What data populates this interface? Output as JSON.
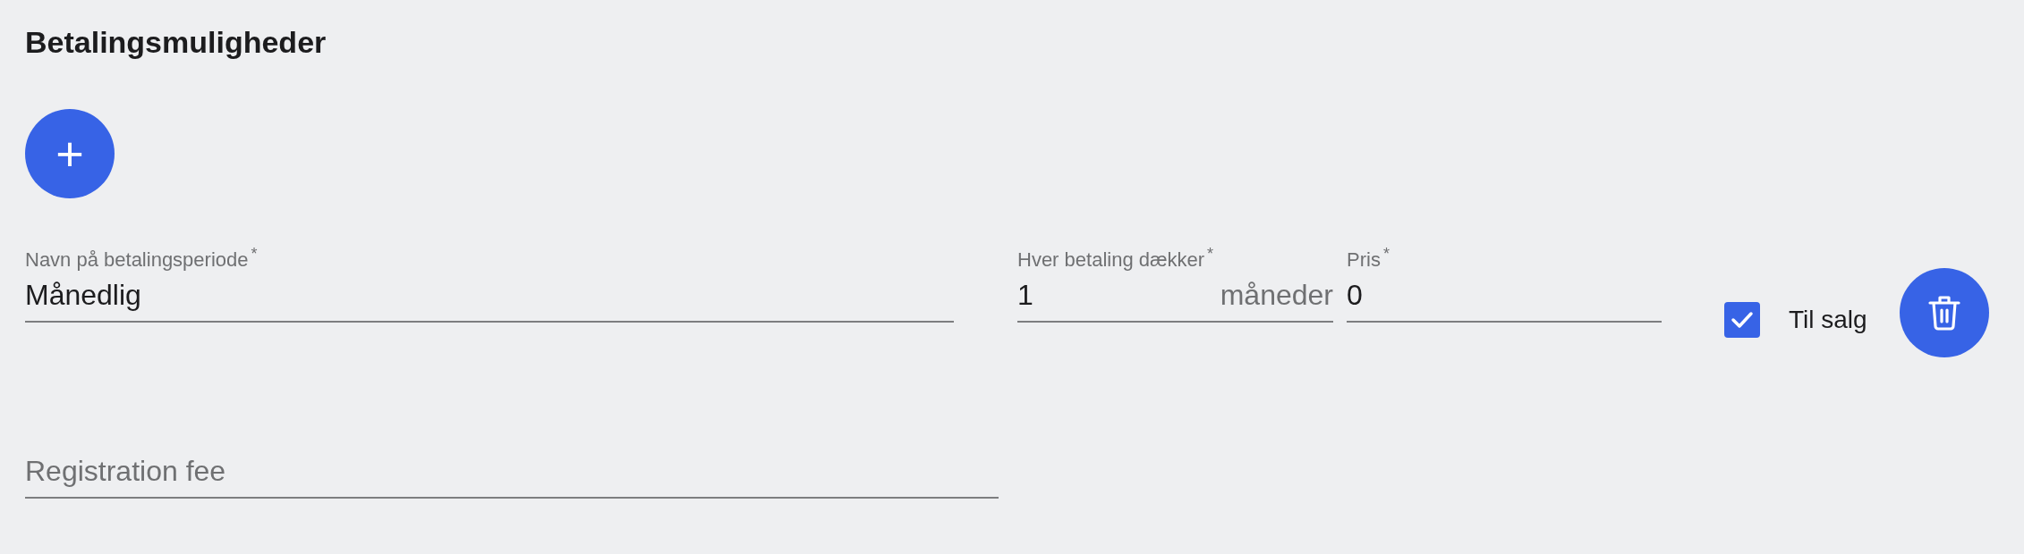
{
  "title": "Betalingsmuligheder",
  "add_button": {
    "label": "+"
  },
  "fields": [
    {
      "kind": "text",
      "label": "Navn på betalingsperiode",
      "required_mark": "*",
      "value": "Månedlig"
    },
    {
      "kind": "unit",
      "label": "Hver betaling dækker",
      "required_mark": "*",
      "value": "1",
      "unit": "måneder"
    },
    {
      "kind": "text",
      "label": "Pris",
      "required_mark": "*",
      "value": "0"
    }
  ],
  "for_sale": {
    "label": "Til salg",
    "checked": true
  },
  "registration_fee": {
    "placeholder": "Registration fee"
  }
}
